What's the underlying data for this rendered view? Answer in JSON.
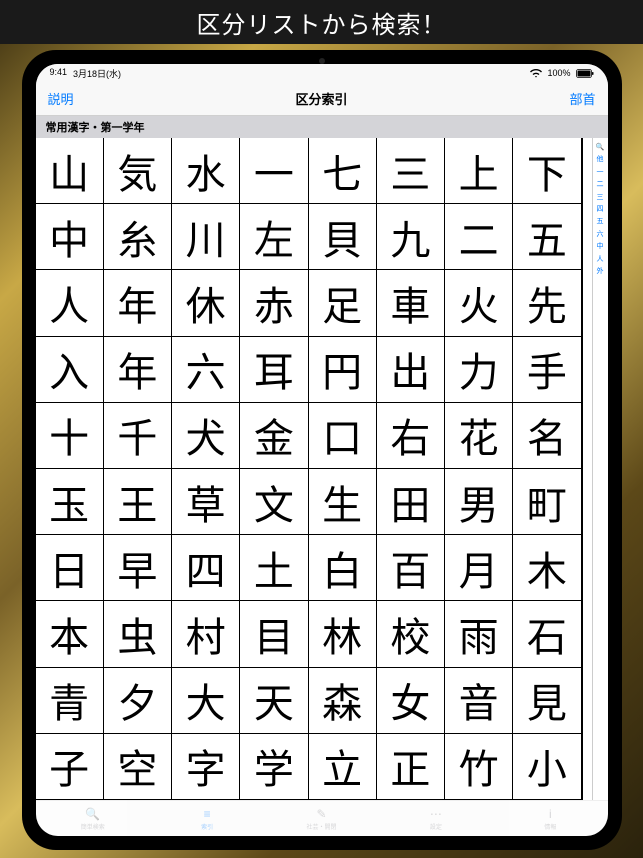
{
  "banner": {
    "text": "区分リストから検索！"
  },
  "status": {
    "time": "9:41",
    "date": "3月18日(水)",
    "battery": "100%"
  },
  "nav": {
    "left": "説明",
    "title": "区分索引",
    "right": "部首"
  },
  "section": {
    "header": "常用漢字・第一学年"
  },
  "kanji_grid": [
    [
      "山",
      "気",
      "水",
      "一",
      "七",
      "三",
      "上",
      "下"
    ],
    [
      "中",
      "糸",
      "川",
      "左",
      "貝",
      "九",
      "二",
      "五"
    ],
    [
      "人",
      "年",
      "休",
      "赤",
      "足",
      "車",
      "火",
      "先"
    ],
    [
      "入",
      "年",
      "六",
      "耳",
      "円",
      "出",
      "力",
      "手"
    ],
    [
      "十",
      "千",
      "犬",
      "金",
      "口",
      "右",
      "花",
      "名"
    ],
    [
      "玉",
      "王",
      "草",
      "文",
      "生",
      "田",
      "男",
      "町"
    ],
    [
      "日",
      "早",
      "四",
      "土",
      "白",
      "百",
      "月",
      "木"
    ],
    [
      "本",
      "虫",
      "村",
      "目",
      "林",
      "校",
      "雨",
      "石"
    ],
    [
      "青",
      "夕",
      "大",
      "天",
      "森",
      "女",
      "音",
      "見"
    ],
    [
      "子",
      "空",
      "字",
      "学",
      "立",
      "正",
      "竹",
      "小"
    ]
  ],
  "side_index": {
    "search_icon": "🔍",
    "items": [
      "他",
      "一",
      "二",
      "三",
      "四",
      "五",
      "六",
      "中",
      "人",
      "外"
    ]
  },
  "tabs": [
    {
      "icon": "🔍",
      "label": "簡単検索"
    },
    {
      "icon": "≡",
      "label": "索引"
    },
    {
      "icon": "✎",
      "label": "社芸・開閉"
    },
    {
      "icon": "⋯",
      "label": "設定"
    },
    {
      "icon": "i",
      "label": "情報"
    }
  ]
}
